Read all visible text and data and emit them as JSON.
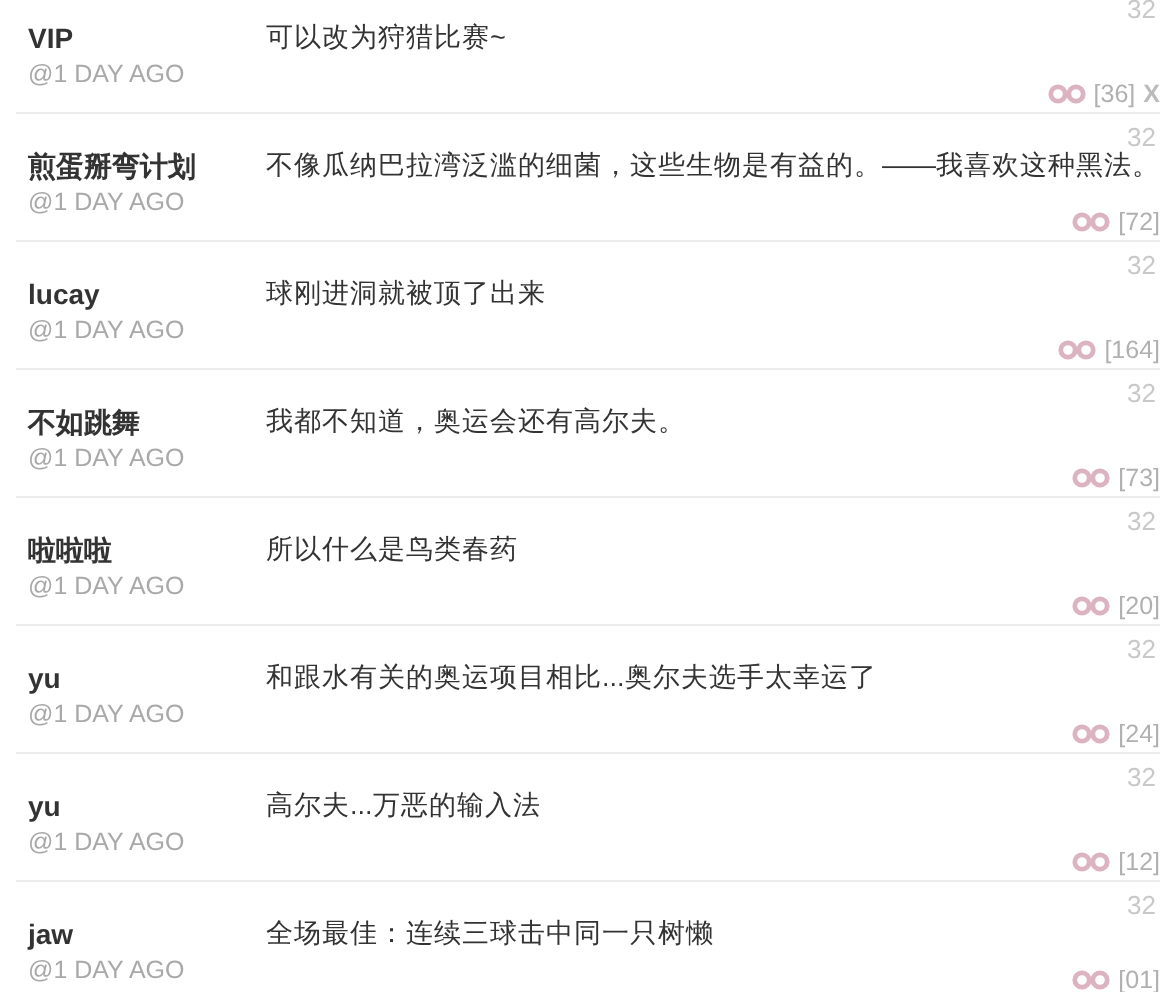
{
  "comments": [
    {
      "user": "VIP",
      "time": "@1 DAY AGO",
      "text": "可以改为狩猎比赛~",
      "score": "32",
      "count": "[36]",
      "action": "X"
    },
    {
      "user": "煎蛋掰弯计划",
      "time": "@1 DAY AGO",
      "text": "不像瓜纳巴拉湾泛滥的细菌，这些生物是有益的。——我喜欢这种黑法。",
      "score": "32",
      "count": "[72]"
    },
    {
      "user": "lucay",
      "time": "@1 DAY AGO",
      "text": "球刚进洞就被顶了出来",
      "score": "32",
      "count": "[164]"
    },
    {
      "user": "不如跳舞",
      "time": "@1 DAY AGO",
      "text": "我都不知道，奥运会还有高尔夫。",
      "score": "32",
      "count": "[73]"
    },
    {
      "user": "啦啦啦",
      "time": "@1 DAY AGO",
      "text": "所以什么是鸟类春药",
      "score": "32",
      "count": "[20]"
    },
    {
      "user": "yu",
      "time": "@1 DAY AGO",
      "text": "和跟水有关的奥运项目相比...奥尔夫选手太幸运了",
      "score": "32",
      "count": "[24]"
    },
    {
      "user": "yu",
      "time": "@1 DAY AGO",
      "text": "高尔夫...万恶的输入法",
      "score": "32",
      "count": "[12]"
    },
    {
      "user": "jaw",
      "time": "@1 DAY AGO",
      "text": "全场最佳：连续三球击中同一只树懒",
      "score": "32",
      "count": "[01]"
    }
  ]
}
